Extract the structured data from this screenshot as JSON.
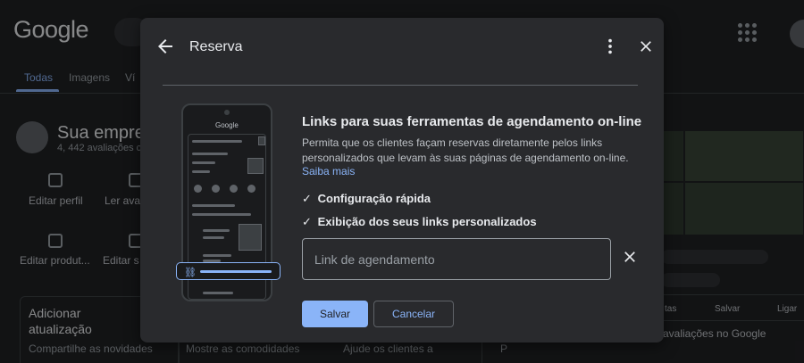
{
  "background": {
    "logo": "Google",
    "tabs": [
      "Todas",
      "Imagens",
      "Ví"
    ],
    "business_name": "Sua empresa",
    "business_sub": "4,  442 avaliações c",
    "actions": [
      "Editar perfil",
      "Ler aval",
      "Editar produt...",
      "Editar s"
    ],
    "card_title": "Adicionar atualização",
    "card_subs": [
      "Compartilhe as novidades",
      "Mostre as comodidades",
      "Ajude os clientes a",
      "P"
    ],
    "right_buttons": [
      "tas",
      "Salvar",
      "Ligar"
    ],
    "right_text": "avaliações no Google"
  },
  "dialog": {
    "title": "Reserva",
    "heading": "Links para suas ferramentas de agendamento on-line",
    "description": "Permita que os clientes façam reservas diretamente pelos links personalizados que levam às suas páginas de agendamento on-line.",
    "learn_more": "Saiba mais",
    "features": [
      "Configuração rápida",
      "Exibição dos seus links personalizados"
    ],
    "input": {
      "value": "",
      "placeholder": "Link de agendamento"
    },
    "save_label": "Salvar",
    "cancel_label": "Cancelar",
    "phone_logo": "Google",
    "check_glyph": "✓",
    "chain_glyph": "⛓"
  },
  "colors": {
    "accent": "#8ab4f8",
    "dialog_bg": "#292a2d",
    "text_primary": "#e8eaed",
    "text_secondary": "#bdc1c6"
  },
  "icons": {
    "back": "arrow-left-icon",
    "more": "more-vert-icon",
    "close": "close-icon",
    "clear": "clear-icon",
    "apps": "apps-grid-icon"
  }
}
